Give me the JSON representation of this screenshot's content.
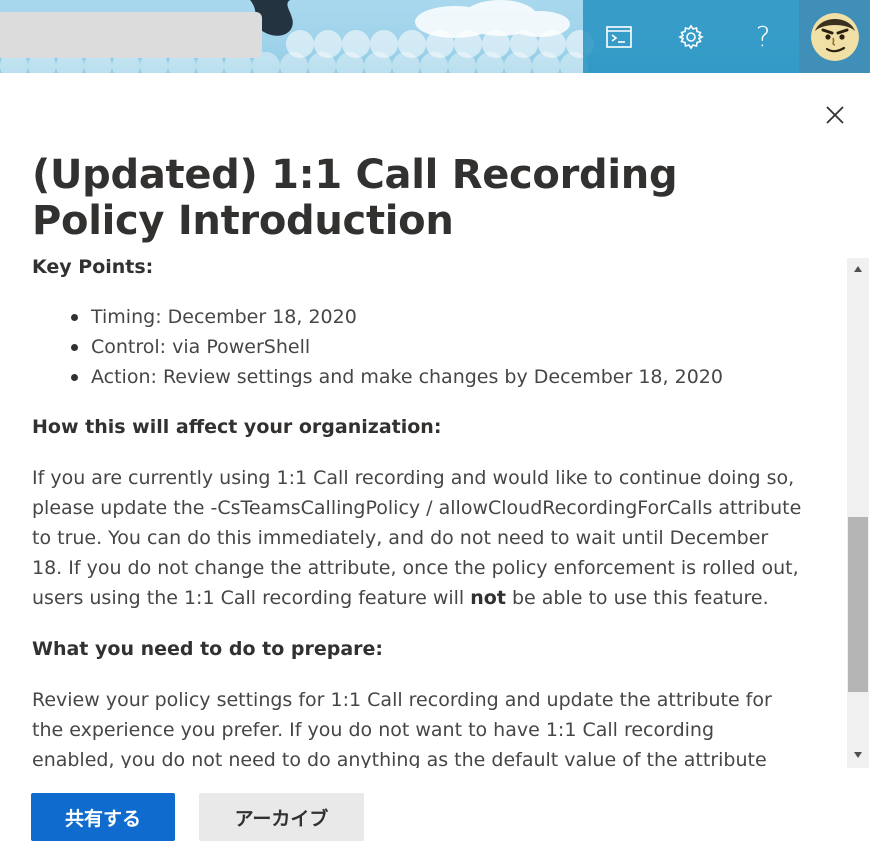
{
  "header": {
    "search_placeholder": "",
    "tools": [
      {
        "icon": "cloud-shell-icon"
      },
      {
        "icon": "gear-icon"
      },
      {
        "icon": "help-icon",
        "glyph": "?"
      }
    ],
    "avatar_icon": "user-avatar-icon"
  },
  "panel": {
    "close_icon": "close-icon",
    "title": "(Updated) 1:1 Call Recording Policy Introduction",
    "key_points_heading": "Key Points:",
    "key_points": [
      "Timing: December 18, 2020",
      "Control: via PowerShell",
      "Action: Review settings and make changes by December 18, 2020"
    ],
    "affect_heading": "How this will affect your organization:",
    "affect_text_before": "If you are currently using 1:1 Call recording and would like to continue doing so, please update the -CsTeamsCallingPolicy / allowCloudRecordingForCalls attribute to true. You can do this immediately, and do not need to wait until December 18. If you do not change the attribute, once the policy enforcement is rolled out, users using the 1:1 Call recording feature will ",
    "affect_text_bold": "not",
    "affect_text_after": " be able to use this feature.",
    "prepare_heading": "What you need to do to prepare:",
    "prepare_text": "Review your policy settings for 1:1 Call recording and update the attribute for the experience you prefer. If you do not want to have 1:1 Call recording enabled, you do not need to do anything as the default value of the attribute will be false."
  },
  "footer": {
    "share_label": "共有する",
    "archive_label": "アーカイブ"
  },
  "colors": {
    "accent": "#0f6cce",
    "header_tools_bg": "#188cbe",
    "scroll_thumb": "#b5b5b5"
  }
}
